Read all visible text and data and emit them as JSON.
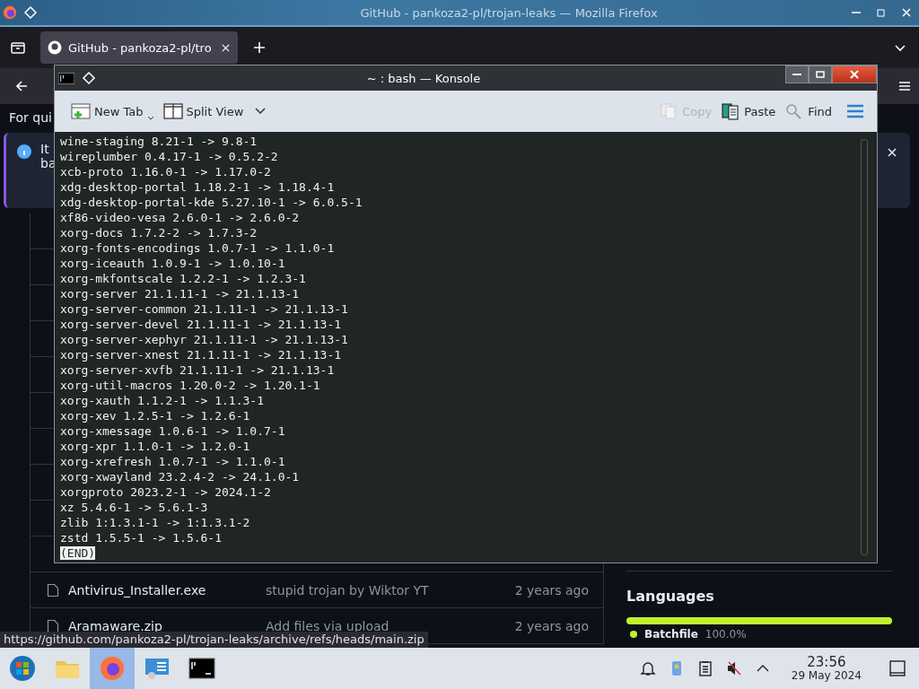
{
  "firefox": {
    "title": "GitHub - pankoza2-pl/trojan-leaks — Mozilla Firefox",
    "tabs": [
      {
        "title": "GitHub - pankoza2-pl/tro",
        "selected": true
      }
    ],
    "hint": "For qui",
    "banner": {
      "lines": [
        "It",
        "ba"
      ]
    },
    "files": [
      {
        "name": "Antivirus_Installer.exe",
        "message": "stupid trojan by Wiktor YT",
        "time": "2 years ago"
      },
      {
        "name": "Aramaware.zip",
        "message": "Add files via upload",
        "time": "2 years ago"
      }
    ],
    "languages_title": "Languages",
    "languages": [
      {
        "name": "Batchfile",
        "percent": "100.0%",
        "color": "#c1f12e",
        "level": 1
      }
    ],
    "status_url": "https://github.com/pankoza2-pl/trojan-leaks/archive/refs/heads/main.zip"
  },
  "konsole": {
    "title": "~ : bash — Konsole",
    "toolbar": [
      {
        "kind": "new-tab",
        "label": "New Tab",
        "disabled": false
      },
      {
        "kind": "split-view",
        "label": "Split View",
        "disabled": false
      },
      {
        "kind": "copy",
        "label": "Copy",
        "disabled": true
      },
      {
        "kind": "paste",
        "label": "Paste",
        "disabled": false
      },
      {
        "kind": "find",
        "label": "Find",
        "disabled": false
      }
    ],
    "lines": [
      "wine-staging 8.21-1 -> 9.8-1",
      "wireplumber 0.4.17-1 -> 0.5.2-2",
      "xcb-proto 1.16.0-1 -> 1.17.0-2",
      "xdg-desktop-portal 1.18.2-1 -> 1.18.4-1",
      "xdg-desktop-portal-kde 5.27.10-1 -> 6.0.5-1",
      "xf86-video-vesa 2.6.0-1 -> 2.6.0-2",
      "xorg-docs 1.7.2-2 -> 1.7.3-2",
      "xorg-fonts-encodings 1.0.7-1 -> 1.1.0-1",
      "xorg-iceauth 1.0.9-1 -> 1.0.10-1",
      "xorg-mkfontscale 1.2.2-1 -> 1.2.3-1",
      "xorg-server 21.1.11-1 -> 21.1.13-1",
      "xorg-server-common 21.1.11-1 -> 21.1.13-1",
      "xorg-server-devel 21.1.11-1 -> 21.1.13-1",
      "xorg-server-xephyr 21.1.11-1 -> 21.1.13-1",
      "xorg-server-xnest 21.1.11-1 -> 21.1.13-1",
      "xorg-server-xvfb 21.1.11-1 -> 21.1.13-1",
      "xorg-util-macros 1.20.0-2 -> 1.20.1-1",
      "xorg-xauth 1.1.2-1 -> 1.1.3-1",
      "xorg-xev 1.2.5-1 -> 1.2.6-1",
      "xorg-xmessage 1.0.6-1 -> 1.0.7-1",
      "xorg-xpr 1.1.0-1 -> 1.2.0-1",
      "xorg-xrefresh 1.0.7-1 -> 1.1.0-1",
      "xorg-xwayland 23.2.4-2 -> 24.1.0-1",
      "xorgproto 2023.2-1 -> 2024.1-2",
      "xz 5.4.6-1 -> 5.6.1-3",
      "zlib 1:1.3.1-1 -> 1:1.3.1-2",
      "zstd 1.5.5-1 -> 1.5.6-1"
    ],
    "prompt": "(END)"
  },
  "taskbar": {
    "apps": [
      {
        "kind": "start",
        "selected": false
      },
      {
        "kind": "files",
        "selected": false
      },
      {
        "kind": "firefox",
        "selected": true
      },
      {
        "kind": "settings",
        "selected": false
      },
      {
        "kind": "terminal",
        "selected": false
      }
    ],
    "time": "23:56",
    "date": "29 May 2024"
  }
}
